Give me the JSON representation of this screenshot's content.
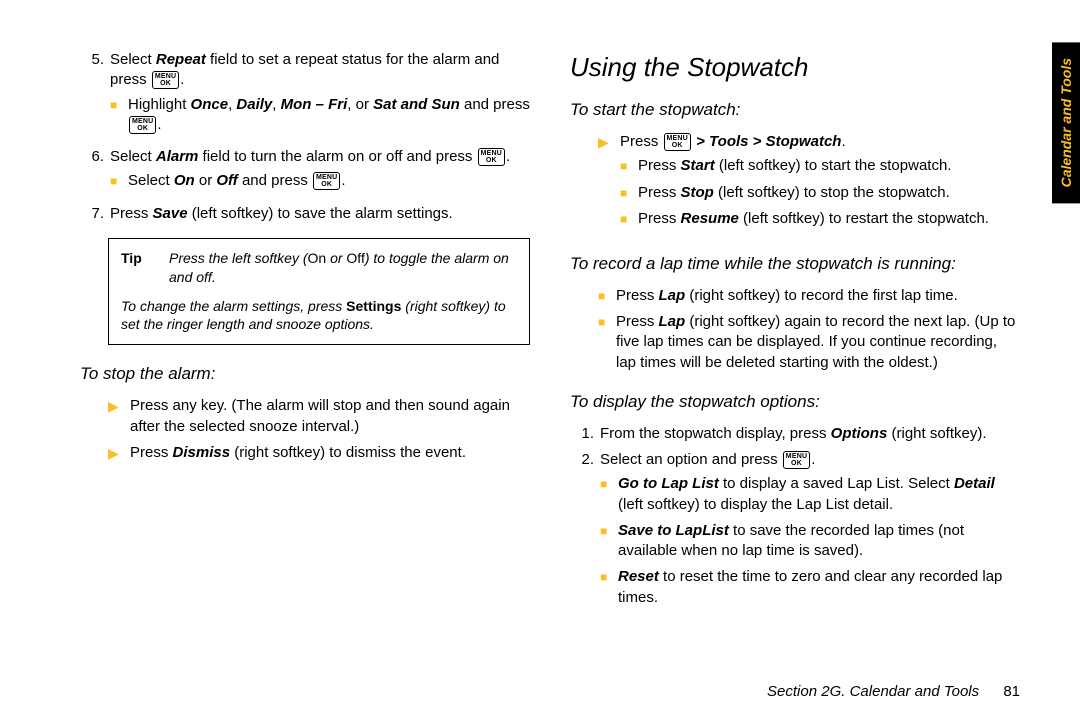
{
  "tab_label": "Calendar and Tools",
  "footer_section": "Section 2G. Calendar and Tools",
  "footer_page": "81",
  "key_top": "MENU",
  "key_bot": "OK",
  "left": {
    "step5_a": "Select ",
    "step5_b": "Repeat",
    "step5_c": " field to set a repeat status for the alarm and press ",
    "step5_sub_a": "Highlight ",
    "step5_sub_b": "Once",
    "step5_sub_c": ", ",
    "step5_sub_d": "Daily",
    "step5_sub_e": ", ",
    "step5_sub_f": "Mon – Fri",
    "step5_sub_g": ", or ",
    "step5_sub_h": "Sat and Sun",
    "step5_sub_i": " and press ",
    "step6_a": "Select ",
    "step6_b": "Alarm",
    "step6_c": " field to turn the alarm on or off and press ",
    "step6_sub_a": "Select ",
    "step6_sub_b": "On",
    "step6_sub_c": " or ",
    "step6_sub_d": "Off",
    "step6_sub_e": " and press ",
    "step7_a": "Press ",
    "step7_b": "Save",
    "step7_c": " (left softkey) to save the alarm settings.",
    "tip_label": "Tip",
    "tip1_a": "Press the left softkey (",
    "tip1_b": "On",
    "tip1_c": " or ",
    "tip1_d": "Off",
    "tip1_e": ") to toggle the alarm on and off.",
    "tip2_a": "To change the alarm settings, press ",
    "tip2_b": "Settings",
    "tip2_c": " (right softkey) to set the ringer length and snooze options.",
    "stop_heading": "To stop the alarm:",
    "stop1": "Press any key. (The alarm will stop and then sound again after the selected snooze interval.)",
    "stop2_a": "Press ",
    "stop2_b": "Dismiss",
    "stop2_c": " (right softkey) to dismiss the event."
  },
  "right": {
    "h2": "Using the Stopwatch",
    "start_heading": "To start the stopwatch:",
    "start_a": "Press ",
    "start_b": " > ",
    "start_c": "Tools",
    "start_d": " > ",
    "start_e": "Stopwatch",
    "start_f": ".",
    "s1_a": "Press ",
    "s1_b": "Start",
    "s1_c": " (left softkey) to start the stopwatch.",
    "s2_a": "Press ",
    "s2_b": "Stop",
    "s2_c": " (left softkey) to stop the stopwatch.",
    "s3_a": "Press ",
    "s3_b": "Resume",
    "s3_c": " (left softkey) to restart the stopwatch.",
    "lap_heading": "To record a lap time while the stopwatch is running:",
    "l1_a": "Press ",
    "l1_b": "Lap",
    "l1_c": " (right softkey) to record the first lap time.",
    "l2_a": "Press ",
    "l2_b": "Lap",
    "l2_c": " (right softkey) again to record the next lap. (Up to five lap times can be displayed. If you continue recording, lap times will be deleted starting with the oldest.)",
    "opt_heading": "To display the stopwatch options:",
    "o1_a": "From the stopwatch display, press ",
    "o1_b": "Options",
    "o1_c": " (right softkey).",
    "o2_a": "Select an option and press ",
    "gl_a": "Go to Lap List",
    "gl_b": " to display a saved Lap List. Select ",
    "gl_c": "Detail",
    "gl_d": " (left softkey) to display the Lap List detail.",
    "sv_a": "Save to LapList",
    "sv_b": " to save the recorded lap times (not available when no lap time is saved).",
    "rs_a": "Reset",
    "rs_b": " to reset the time to zero and clear any recorded lap times."
  }
}
